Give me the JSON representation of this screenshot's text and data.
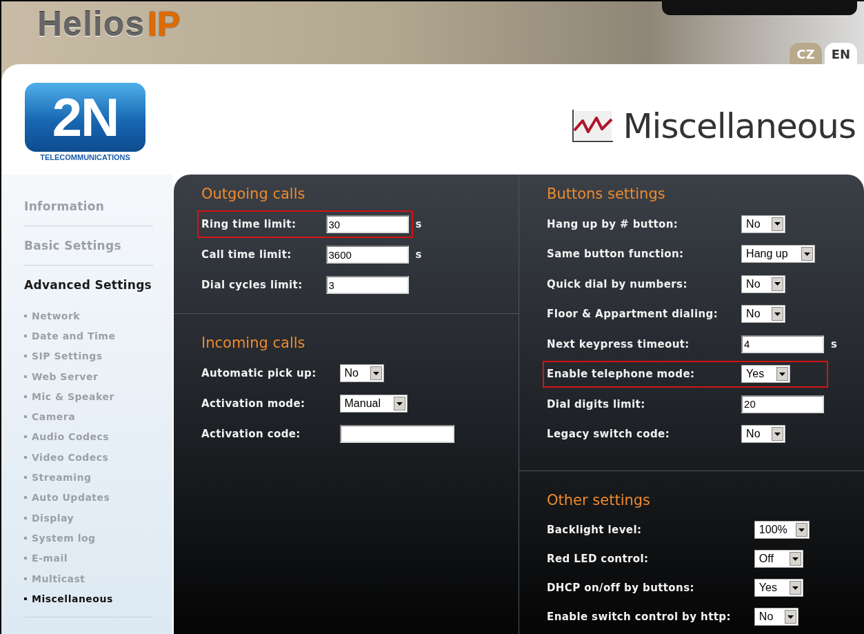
{
  "header": {
    "logo": {
      "text": "Helios",
      "suffix": "IP"
    },
    "languages": [
      {
        "label": "CZ",
        "selected": false
      },
      {
        "label": "EN",
        "selected": true
      }
    ]
  },
  "brand": {
    "logo": "2N",
    "tagline": "TELECOMMUNICATIONS"
  },
  "page_title": "Miscellaneous",
  "sidebar": {
    "items": [
      {
        "label": "Information",
        "selected": false
      },
      {
        "label": "Basic Settings",
        "selected": false
      },
      {
        "label": "Advanced Settings",
        "selected": true,
        "children": [
          {
            "label": "Network",
            "selected": false
          },
          {
            "label": "Date and Time",
            "selected": false
          },
          {
            "label": "SIP Settings",
            "selected": false
          },
          {
            "label": "Web Server",
            "selected": false
          },
          {
            "label": "Mic & Speaker",
            "selected": false
          },
          {
            "label": "Camera",
            "selected": false
          },
          {
            "label": "Audio Codecs",
            "selected": false
          },
          {
            "label": "Video Codecs",
            "selected": false
          },
          {
            "label": "Streaming",
            "selected": false
          },
          {
            "label": "Auto Updates",
            "selected": false
          },
          {
            "label": "Display",
            "selected": false
          },
          {
            "label": "System log",
            "selected": false
          },
          {
            "label": "E-mail",
            "selected": false
          },
          {
            "label": "Multicast",
            "selected": false
          },
          {
            "label": "Miscellaneous",
            "selected": true
          }
        ]
      }
    ]
  },
  "columns": [
    {
      "sections": [
        {
          "title": "Outgoing calls",
          "fields": [
            {
              "label": "Ring time limit:",
              "kind": "text",
              "value": "30",
              "unit": "s",
              "highlighted": true
            },
            {
              "label": "Call time limit:",
              "kind": "text",
              "value": "3600",
              "unit": "s",
              "highlighted": false
            },
            {
              "label": "Dial cycles limit:",
              "kind": "text",
              "value": "3",
              "highlighted": false
            }
          ]
        },
        {
          "title": "Incoming calls",
          "fields": [
            {
              "label": "Automatic pick up:",
              "kind": "select",
              "value": "No",
              "highlighted": false
            },
            {
              "label": "Activation mode:",
              "kind": "select",
              "value": "Manual",
              "highlighted": false
            },
            {
              "label": "Activation code:",
              "kind": "text",
              "highlighted": false
            }
          ]
        }
      ]
    },
    {
      "sections": [
        {
          "title": "Buttons settings",
          "fields": [
            {
              "label": "Hang up by # button:",
              "kind": "select",
              "value": "No",
              "highlighted": false
            },
            {
              "label": "Same button function:",
              "kind": "select",
              "value": "Hang up",
              "highlighted": false
            },
            {
              "label": "Quick dial by numbers:",
              "kind": "select",
              "value": "No",
              "highlighted": false
            },
            {
              "label": "Floor & Appartment dialing:",
              "kind": "select",
              "value": "No",
              "highlighted": false
            },
            {
              "label": "Next keypress timeout:",
              "kind": "text",
              "value": "4",
              "unit": "s",
              "highlighted": false
            },
            {
              "label": "Enable telephone mode:",
              "kind": "select",
              "value": "Yes",
              "highlighted": true
            },
            {
              "label": "Dial digits limit:",
              "kind": "text",
              "value": "20",
              "highlighted": false
            },
            {
              "label": "Legacy switch code:",
              "kind": "select",
              "value": "No",
              "highlighted": false
            }
          ]
        },
        {
          "title": "Other settings",
          "fields": [
            {
              "label": "Backlight level:",
              "kind": "select",
              "value": "100%",
              "highlighted": false
            },
            {
              "label": "Red LED control:",
              "kind": "select",
              "value": "Off",
              "highlighted": false
            },
            {
              "label": "DHCP on/off by buttons:",
              "kind": "select",
              "value": "Yes",
              "highlighted": false
            },
            {
              "label": "Enable switch control by http:",
              "kind": "select",
              "value": "No",
              "highlighted": false
            }
          ]
        }
      ]
    }
  ]
}
